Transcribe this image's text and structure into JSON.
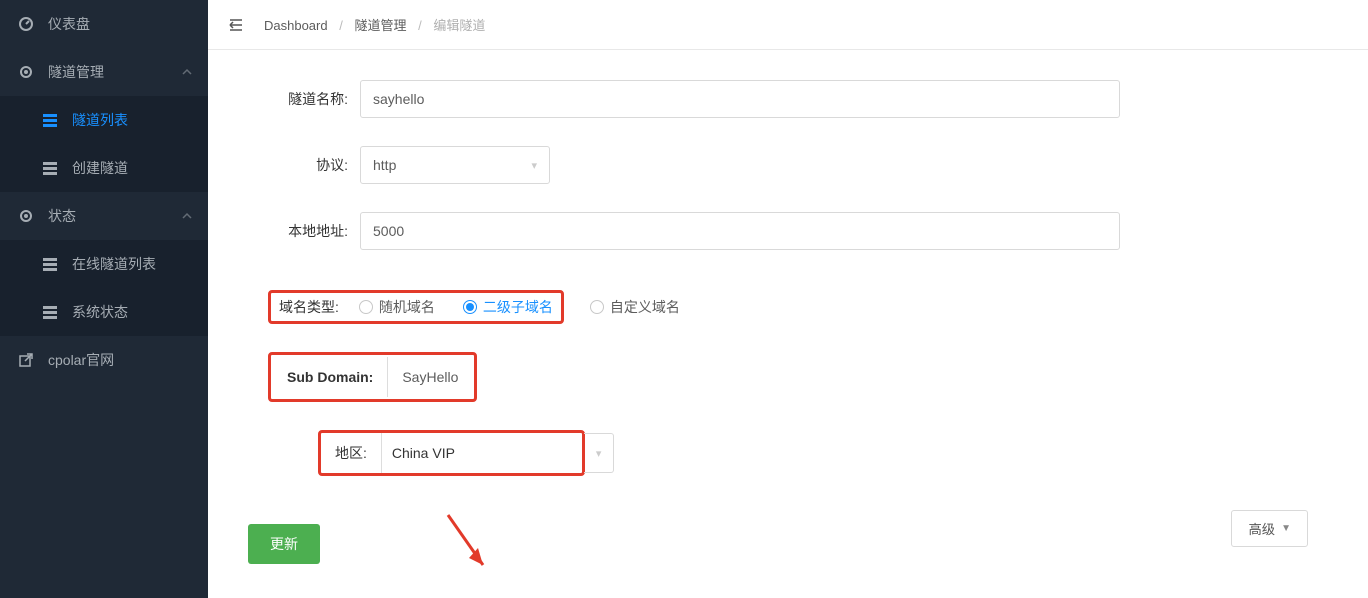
{
  "sidebar": {
    "dashboard": "仪表盘",
    "tunnel_mgmt": "隧道管理",
    "tunnel_list": "隧道列表",
    "tunnel_create": "创建隧道",
    "status": "状态",
    "online_list": "在线隧道列表",
    "sys_status": "系统状态",
    "cpolar_site": "cpolar官网"
  },
  "breadcrumb": {
    "a": "Dashboard",
    "b": "隧道管理",
    "c": "编辑隧道"
  },
  "form": {
    "name_label": "隧道名称:",
    "name_value": "sayhello",
    "proto_label": "协议:",
    "proto_value": "http",
    "local_label": "本地地址:",
    "local_value": "5000",
    "domain_type_label": "域名类型:",
    "domain_opt_random": "随机域名",
    "domain_opt_sub": "二级子域名",
    "domain_opt_custom": "自定义域名",
    "subdomain_label": "Sub Domain:",
    "subdomain_value": "SayHello",
    "region_label": "地区:",
    "region_value": "China VIP",
    "advanced_label": "高级",
    "update_label": "更新"
  }
}
